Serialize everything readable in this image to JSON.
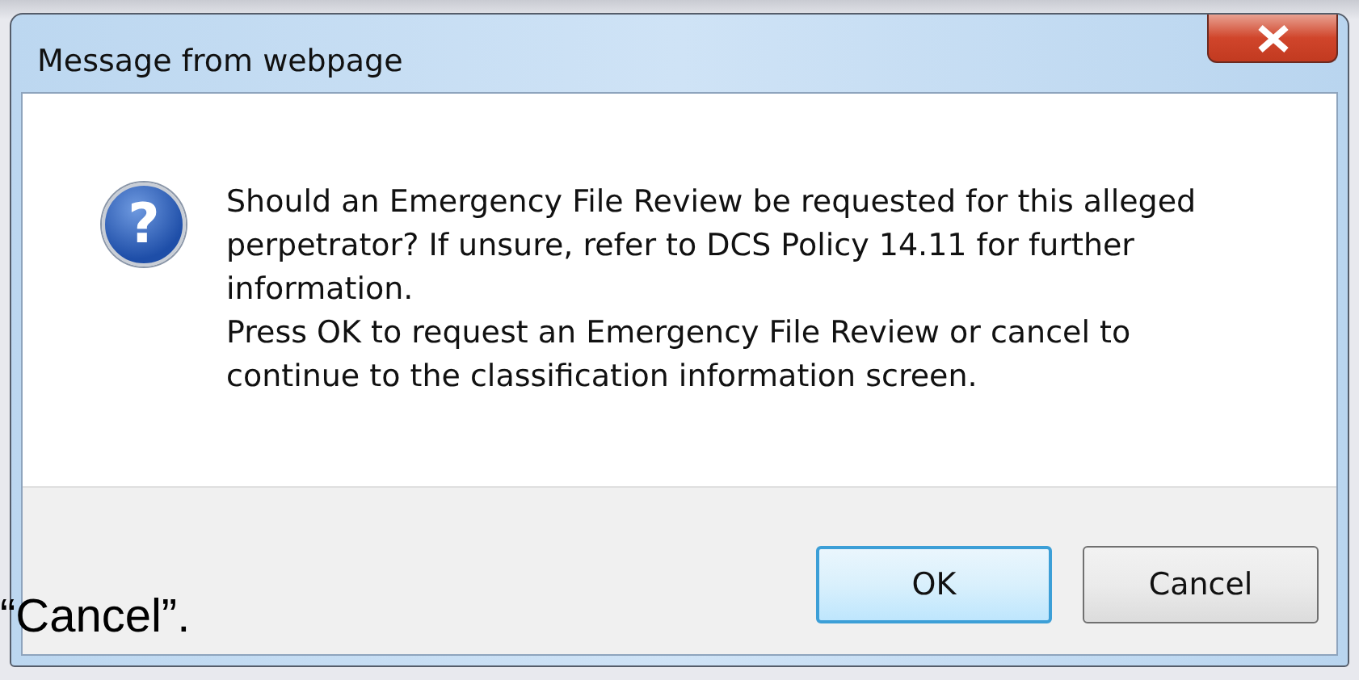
{
  "window": {
    "title": "Message from webpage"
  },
  "icon": {
    "glyph": "?"
  },
  "message": [
    "Should an Emergency File Review be requested for this alleged perpetrator? If unsure, refer to DCS Policy 14.11 for further information.",
    "Press OK to request an Emergency File Review or cancel to continue to the classification information screen."
  ],
  "buttons": [
    {
      "label": "OK",
      "selected": true
    },
    {
      "label": "Cancel",
      "selected": false
    }
  ],
  "background_text": "“Cancel”."
}
